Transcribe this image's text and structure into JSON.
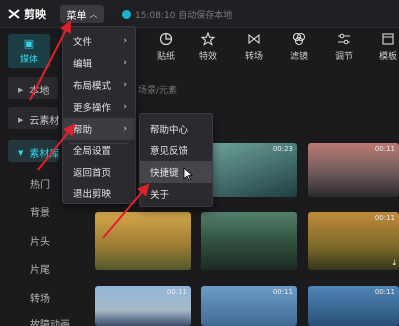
{
  "app": {
    "name": "剪映",
    "menu_label": "菜单",
    "save_status": "15:08:10 自动保存本地"
  },
  "left_tab": {
    "label": "媒体"
  },
  "toolbar": [
    {
      "label": "贴纸",
      "icon": "sticker-icon"
    },
    {
      "label": "特效",
      "icon": "effects-icon"
    },
    {
      "label": "转场",
      "icon": "transition-icon"
    },
    {
      "label": "滤镜",
      "icon": "filter-icon"
    },
    {
      "label": "调节",
      "icon": "adjust-icon"
    },
    {
      "label": "模板",
      "icon": "template-icon"
    }
  ],
  "sidebar": {
    "items": [
      {
        "label": "本地"
      },
      {
        "label": "云素材"
      },
      {
        "label": "素材库"
      }
    ],
    "sub_items": [
      "热门",
      "背景",
      "片头",
      "片尾",
      "转场",
      "故障动画"
    ]
  },
  "search_hint": "场景/元素",
  "main_menu": {
    "items": [
      {
        "label": "文件",
        "has_submenu": true
      },
      {
        "label": "编辑",
        "has_submenu": true
      },
      {
        "label": "布局模式",
        "has_submenu": true
      },
      {
        "label": "更多操作",
        "has_submenu": true
      },
      {
        "label": "帮助",
        "has_submenu": true
      },
      {
        "label": "全局设置",
        "has_submenu": false
      },
      {
        "label": "返回首页",
        "has_submenu": false
      },
      {
        "label": "退出剪映",
        "has_submenu": false
      }
    ]
  },
  "help_menu": {
    "items": [
      {
        "label": "帮助中心"
      },
      {
        "label": "意见反馈"
      },
      {
        "label": "快捷键"
      },
      {
        "label": "关于"
      }
    ]
  },
  "thumbnails": [
    {
      "time": "00:23",
      "color": "#3a6f6a"
    },
    {
      "time": "00:11",
      "color": "#8a5a55"
    },
    {
      "time": "",
      "color": "#b48a3a"
    },
    {
      "time": "",
      "color": "#2f4d3a"
    },
    {
      "time": "00:11",
      "color": "#6d5a2a"
    },
    {
      "time": "00:11",
      "color": "#5a7fa8"
    },
    {
      "time": "00:11",
      "color": "#4a6a8a"
    },
    {
      "time": "00:11",
      "color": "#3f6e94"
    }
  ],
  "colors": {
    "accent": "#39d0e5",
    "arrow": "#e0202a"
  }
}
